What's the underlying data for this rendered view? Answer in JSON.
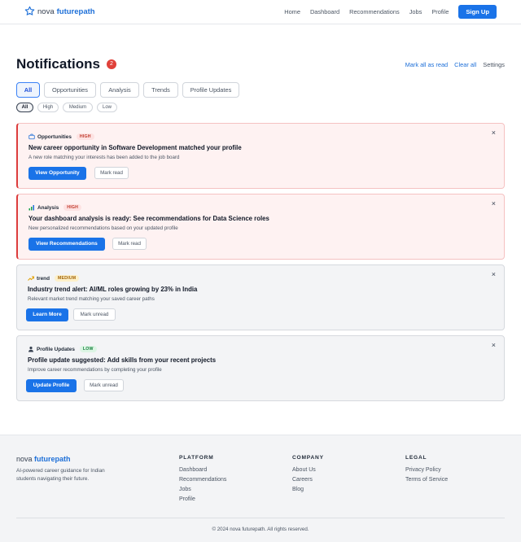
{
  "header": {
    "brand_prefix": "nova",
    "brand_name": "futurepath",
    "nav": [
      "Home",
      "Dashboard",
      "Recommendations",
      "Jobs",
      "Profile"
    ],
    "signup_label": "Sign Up"
  },
  "page": {
    "title": "Notifications",
    "unread_count": "2",
    "actions": {
      "mark_all": "Mark all as read",
      "clear_all": "Clear all",
      "settings": "Settings"
    }
  },
  "tabs": [
    "All",
    "Opportunities",
    "Analysis",
    "Trends",
    "Profile Updates"
  ],
  "active_tab": "All",
  "priority_filters": [
    "All",
    "High",
    "Medium",
    "Low"
  ],
  "notifications": [
    {
      "category": "Opportunities",
      "priority": "HIGH",
      "title": "New career opportunity in Software Development matched your profile",
      "description": "A new role matching your interests has been added to the job board",
      "primary_action": "View Opportunity",
      "secondary_action": "Mark read",
      "icon": "briefcase-icon",
      "unread": true
    },
    {
      "category": "Analysis",
      "priority": "HIGH",
      "title": "Your dashboard analysis is ready: See recommendations for Data Science roles",
      "description": "New personalized recommendations based on your updated profile",
      "primary_action": "View Recommendations",
      "secondary_action": "Mark read",
      "icon": "bar-chart-icon",
      "unread": true
    },
    {
      "category": "trend",
      "priority": "MEDIUM",
      "title": "Industry trend alert: AI/ML roles growing by 23% in India",
      "description": "Relevant market trend matching your saved career paths",
      "primary_action": "Learn More",
      "secondary_action": "Mark unread",
      "icon": "trending-up-icon",
      "unread": false
    },
    {
      "category": "Profile Updates",
      "priority": "LOW",
      "title": "Profile update suggested: Add skills from your recent projects",
      "description": "Improve career recommendations by completing your profile",
      "primary_action": "Update Profile",
      "secondary_action": "Mark unread",
      "icon": "user-icon",
      "unread": false
    }
  ],
  "close_glyph": "×",
  "footer": {
    "brand_prefix": "nova",
    "brand_name": "futurepath",
    "tagline": "AI-powered career guidance for Indian students navigating their future.",
    "columns": [
      {
        "heading": "PLATFORM",
        "links": [
          "Dashboard",
          "Recommendations",
          "Jobs",
          "Profile"
        ]
      },
      {
        "heading": "COMPANY",
        "links": [
          "About Us",
          "Careers",
          "Blog"
        ]
      },
      {
        "heading": "LEGAL",
        "links": [
          "Privacy Policy",
          "Terms of Service"
        ]
      }
    ],
    "copyright": "© 2024 nova futurepath. All rights reserved."
  },
  "colors": {
    "brand": "#1a73e8",
    "badge": "#e0413a",
    "unread_accent": "#dc3c3c"
  }
}
